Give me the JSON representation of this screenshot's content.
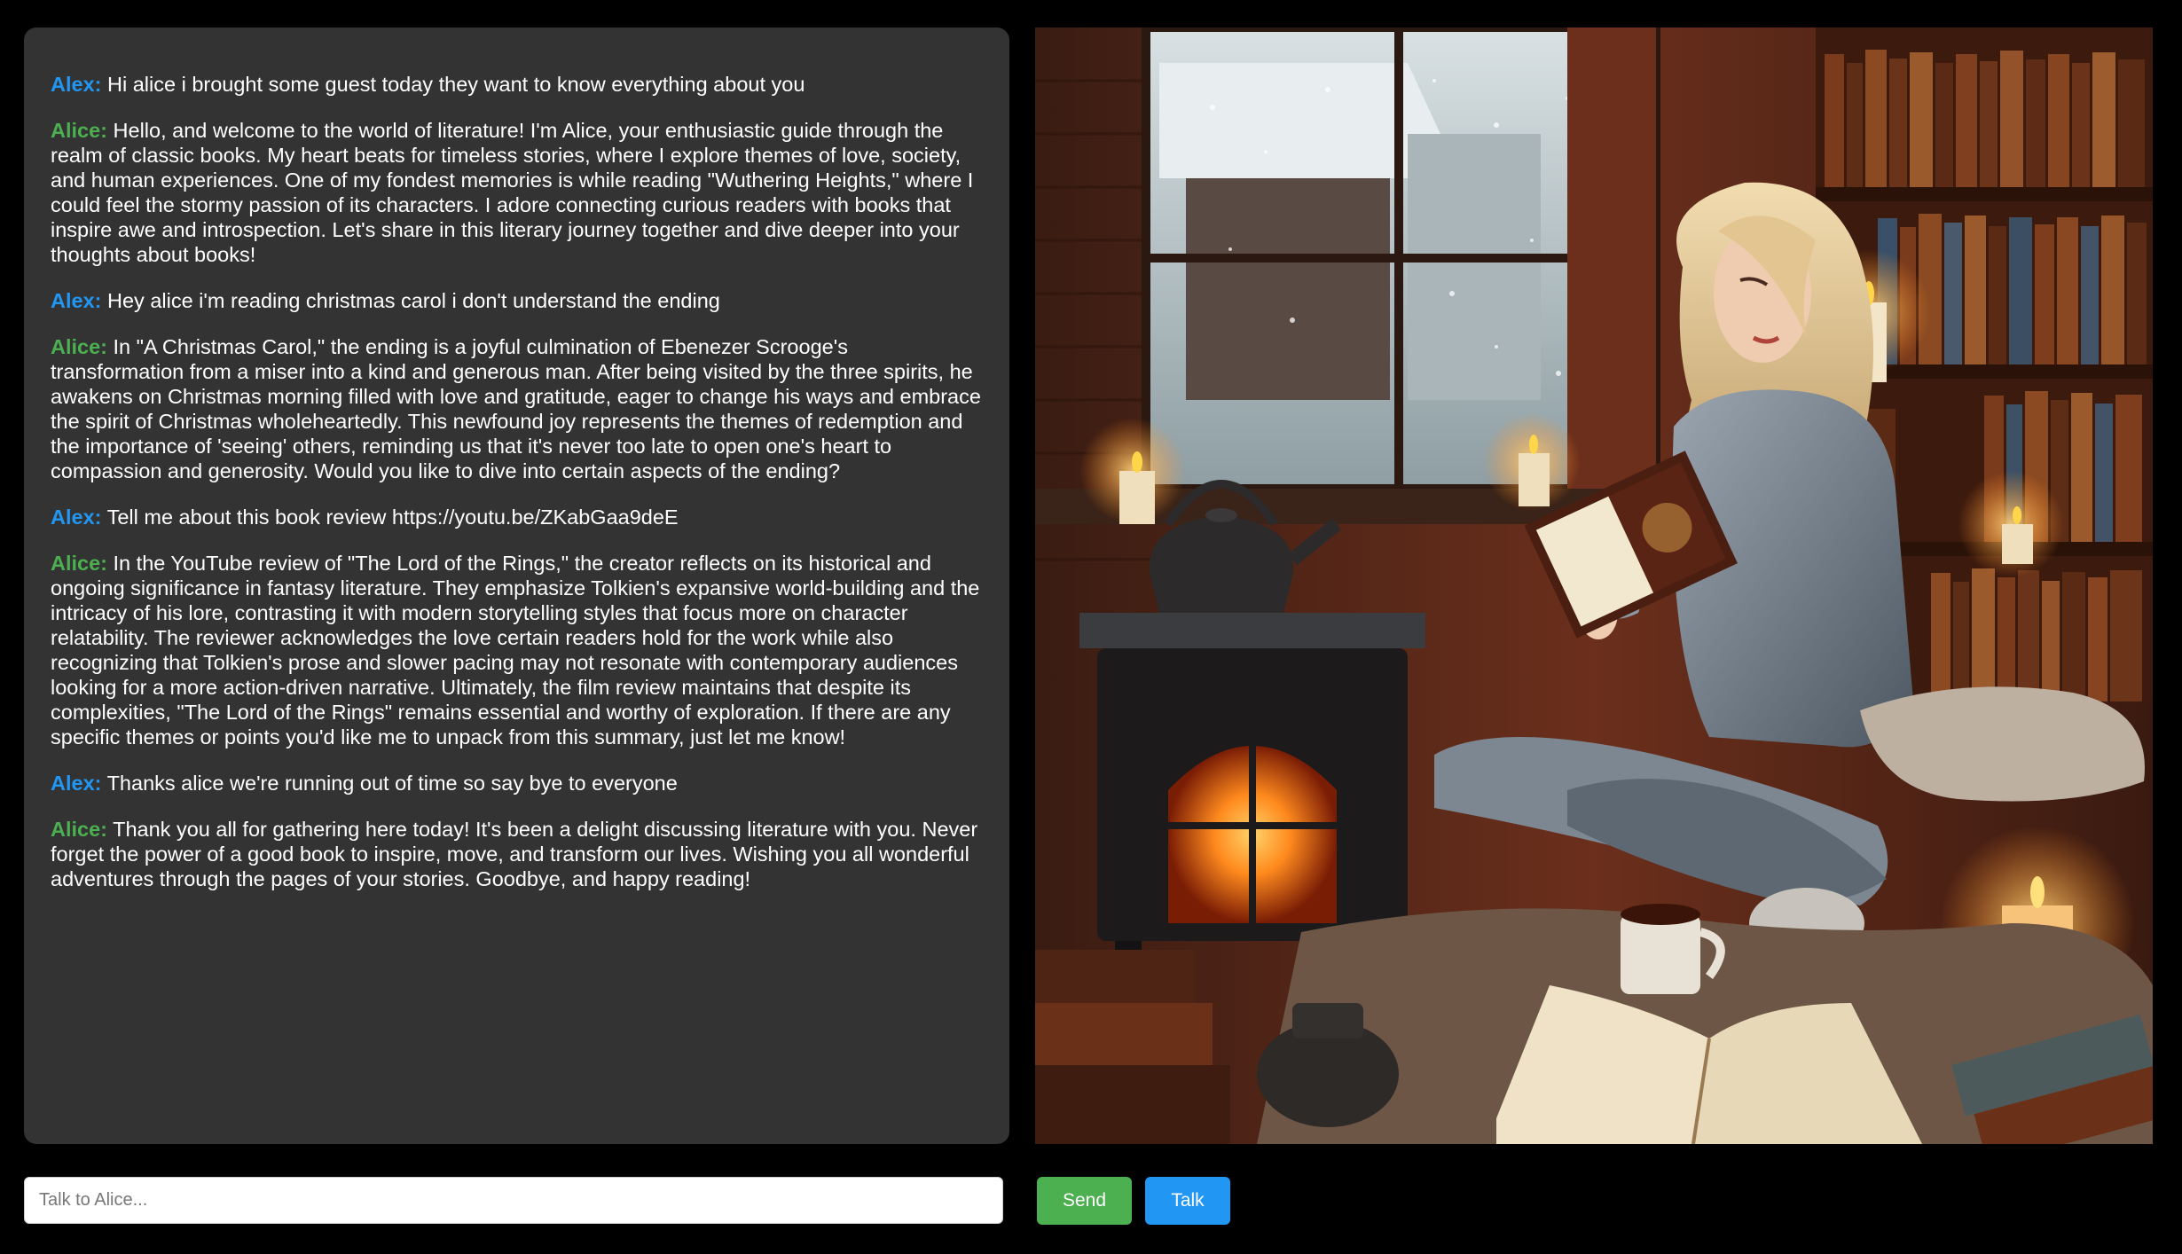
{
  "chat": {
    "messages": [
      {
        "speaker": "Alex:",
        "role": "user",
        "text": "Hi alice i brought some guest today they want to know everything about you"
      },
      {
        "speaker": "Alice:",
        "role": "bot",
        "text": "Hello, and welcome to the world of literature! I'm Alice, your enthusiastic guide through the realm of classic books. My heart beats for timeless stories, where I explore themes of love, society, and human experiences. One of my fondest memories is while reading \"Wuthering Heights,\" where I could feel the stormy passion of its characters. I adore connecting curious readers with books that inspire awe and introspection. Let's share in this literary journey together and dive deeper into your thoughts about books!"
      },
      {
        "speaker": "Alex:",
        "role": "user",
        "text": "Hey alice i'm reading christmas carol i don't understand the ending"
      },
      {
        "speaker": "Alice:",
        "role": "bot",
        "text": "In \"A Christmas Carol,\" the ending is a joyful culmination of Ebenezer Scrooge's transformation from a miser into a kind and generous man. After being visited by the three spirits, he awakens on Christmas morning filled with love and gratitude, eager to change his ways and embrace the spirit of Christmas wholeheartedly. This newfound joy represents the themes of redemption and the importance of 'seeing' others, reminding us that it's never too late to open one's heart to compassion and generosity. Would you like to dive into certain aspects of the ending?"
      },
      {
        "speaker": "Alex:",
        "role": "user",
        "text": "Tell me about this book review https://youtu.be/ZKabGaa9deE"
      },
      {
        "speaker": "Alice:",
        "role": "bot",
        "text": "In the YouTube review of \"The Lord of the Rings,\" the creator reflects on its historical and ongoing significance in fantasy literature. They emphasize Tolkien's expansive world-building and the intricacy of his lore, contrasting it with modern storytelling styles that focus more on character relatability. The reviewer acknowledges the love certain readers hold for the work while also recognizing that Tolkien's prose and slower pacing may not resonate with contemporary audiences looking for a more action-driven narrative. Ultimately, the film review maintains that despite its complexities, \"The Lord of the Rings\" remains essential and worthy of exploration. If there are any specific themes or points you'd like me to unpack from this summary, just let me know!"
      },
      {
        "speaker": "Alex:",
        "role": "user",
        "text": "Thanks alice we're running out of time so say bye to everyone"
      },
      {
        "speaker": "Alice:",
        "role": "bot",
        "text": "Thank you all for gathering here today! It's been a delight discussing literature with you. Never forget the power of a good book to inspire, move, and transform our lives. Wishing you all wonderful adventures through the pages of your stories. Goodbye, and happy reading!"
      }
    ]
  },
  "input": {
    "placeholder": "Talk to Alice...",
    "value": ""
  },
  "buttons": {
    "send_label": "Send",
    "talk_label": "Talk"
  },
  "colors": {
    "user_name": "#2196f3",
    "bot_name": "#4caf50",
    "panel_bg": "#333333",
    "page_bg": "#000000",
    "send_button": "#4caf50",
    "talk_button": "#2196f3"
  },
  "avatar": {
    "description_icon": "reading-woman-fireplace-illustration"
  }
}
